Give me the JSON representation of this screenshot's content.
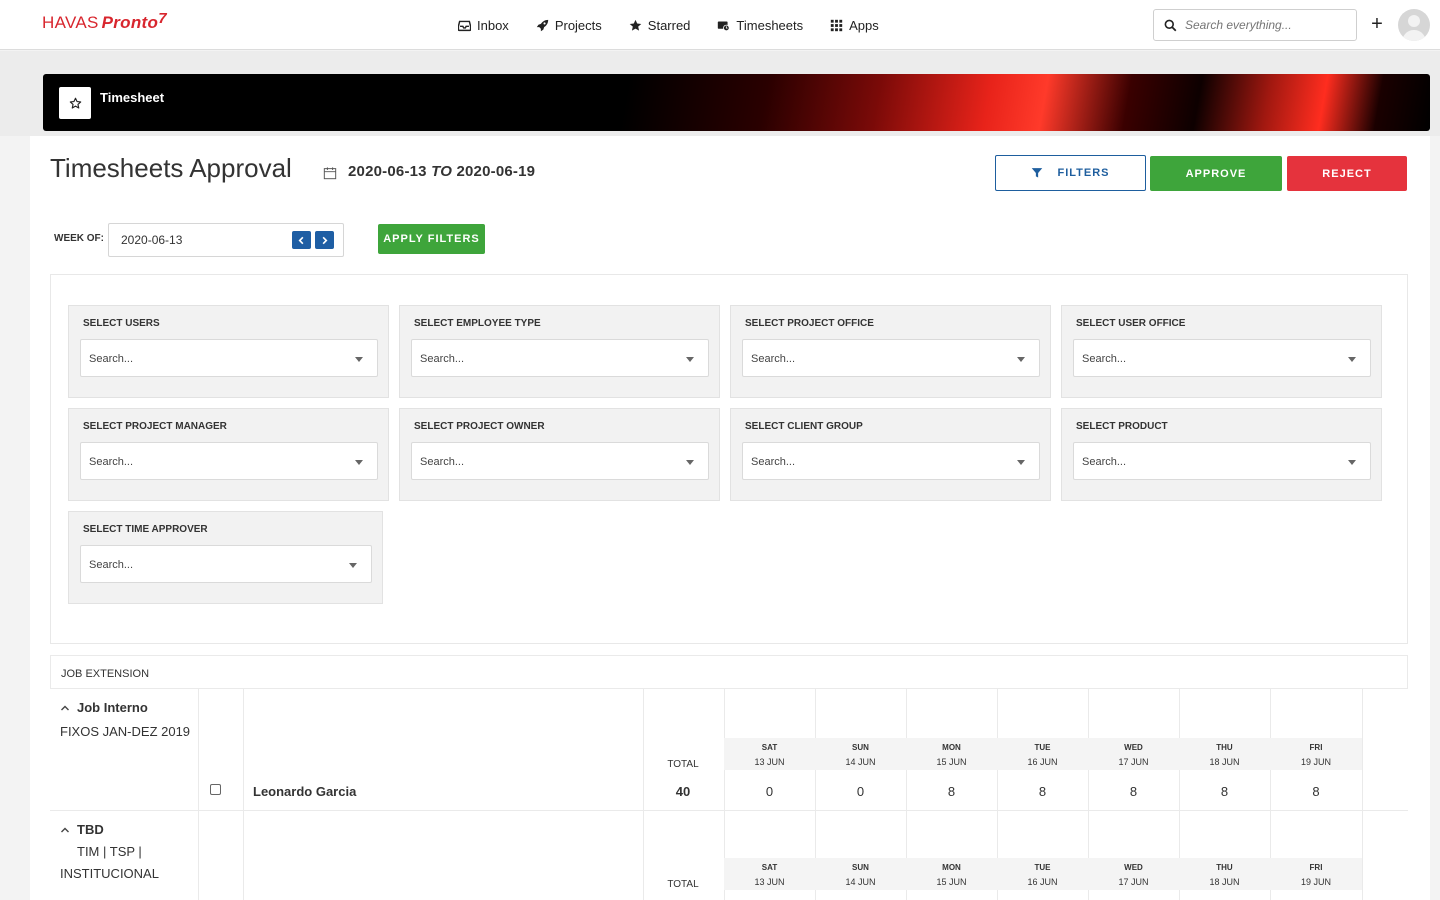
{
  "brand": {
    "name1": "HAVAS",
    "name2": "Pronto",
    "mark": "7"
  },
  "nav": [
    {
      "label": "Inbox",
      "icon": "inbox-icon"
    },
    {
      "label": "Projects",
      "icon": "rocket-icon"
    },
    {
      "label": "Starred",
      "icon": "star-icon"
    },
    {
      "label": "Timesheets",
      "icon": "timesheets-icon"
    },
    {
      "label": "Apps",
      "icon": "grid-icon"
    }
  ],
  "search": {
    "placeholder": "Search everything..."
  },
  "header_actions": {
    "add_label": "+"
  },
  "banner": {
    "title": "Timesheet"
  },
  "page": {
    "title": "Timesheets Approval",
    "date_from": "2020-06-13",
    "date_to_word": "TO",
    "date_to": "2020-06-19"
  },
  "actions": {
    "filters": "FILTERS",
    "approve": "APPROVE",
    "reject": "REJECT"
  },
  "week": {
    "label": "WEEK OF:",
    "value": "2020-06-13",
    "apply": "APPLY FILTERS"
  },
  "filters": [
    {
      "title": "SELECT USERS",
      "placeholder": "Search..."
    },
    {
      "title": "SELECT EMPLOYEE TYPE",
      "placeholder": "Search..."
    },
    {
      "title": "SELECT PROJECT OFFICE",
      "placeholder": "Search..."
    },
    {
      "title": "SELECT USER OFFICE",
      "placeholder": "Search..."
    },
    {
      "title": "SELECT PROJECT MANAGER",
      "placeholder": "Search..."
    },
    {
      "title": "SELECT PROJECT OWNER",
      "placeholder": "Search..."
    },
    {
      "title": "SELECT CLIENT GROUP",
      "placeholder": "Search..."
    },
    {
      "title": "SELECT PRODUCT",
      "placeholder": "Search..."
    },
    {
      "title": "SELECT TIME APPROVER",
      "placeholder": "Search..."
    }
  ],
  "table": {
    "section_label": "JOB EXTENSION",
    "total_label": "TOTAL",
    "days": [
      {
        "dow": "SAT",
        "date": "13 JUN"
      },
      {
        "dow": "SUN",
        "date": "14 JUN"
      },
      {
        "dow": "MON",
        "date": "15 JUN"
      },
      {
        "dow": "TUE",
        "date": "16 JUN"
      },
      {
        "dow": "WED",
        "date": "17 JUN"
      },
      {
        "dow": "THU",
        "date": "18 JUN"
      },
      {
        "dow": "FRI",
        "date": "19 JUN"
      }
    ],
    "rows": [
      {
        "job": "Job Interno",
        "desc": "FIXOS JAN-DEZ 2019",
        "person": "Leonardo Garcia",
        "total": "40",
        "hours": [
          "0",
          "0",
          "8",
          "8",
          "8",
          "8",
          "8"
        ]
      },
      {
        "job": "TBD",
        "desc": "TIM | TSP | INSTITUCIONAL"
      }
    ]
  }
}
